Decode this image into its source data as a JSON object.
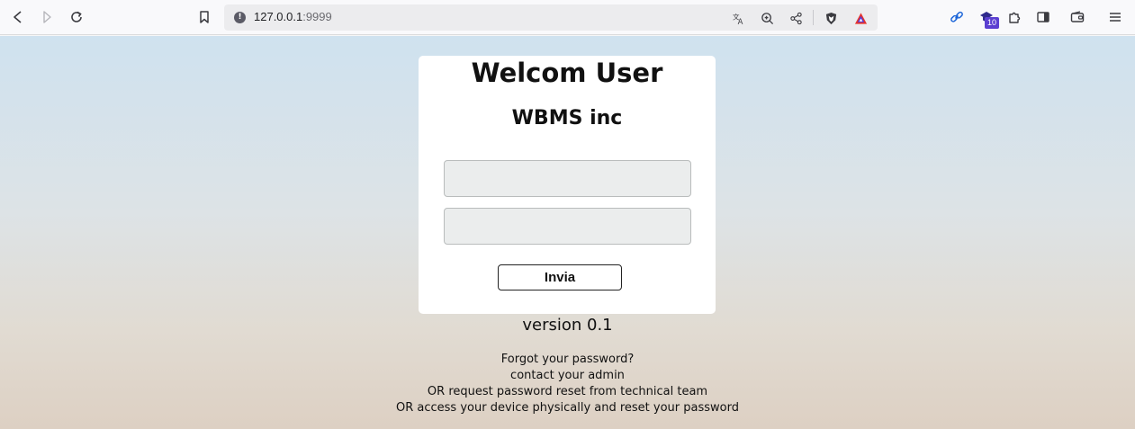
{
  "browser": {
    "url_host": "127.0.0.1",
    "url_port": ":9999",
    "extension_badge": "10",
    "icons": [
      "back-icon",
      "forward-icon",
      "reload-icon",
      "bookmark-icon",
      "site-info-icon",
      "translate-icon",
      "zoom-icon",
      "share-icon",
      "brave-shields-icon",
      "brave-rewards-icon",
      "link-extension-icon",
      "graduation-cap-extension-icon",
      "extensions-puzzle-icon",
      "sidebar-icon",
      "wallet-icon",
      "menu-icon"
    ]
  },
  "login": {
    "title": "Welcom User",
    "company": "WBMS inc",
    "username_value": "",
    "password_value": "",
    "submit_label": "Invia"
  },
  "footer": {
    "version": "version 0.1",
    "help_lines": [
      "Forgot your password?",
      "contact your admin",
      "OR request password reset from technical team",
      "OR access your device physically and reset your password"
    ]
  },
  "colors": {
    "toolbar_bg": "#f9f9fb",
    "card_bg": "#ffffff",
    "field_bg": "#ebeded",
    "gradient_top": "#cfe2ef",
    "gradient_bottom": "#ddd0c3",
    "badge": "#5b3fd1"
  }
}
